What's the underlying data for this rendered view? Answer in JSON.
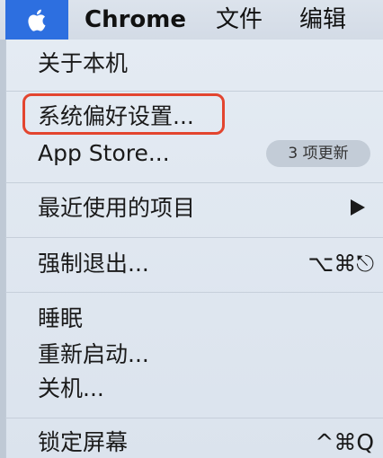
{
  "menubar": {
    "apple_icon": "apple-icon",
    "app_name": "Chrome",
    "menus": [
      "文件",
      "编辑"
    ]
  },
  "apple_menu": {
    "about": "关于本机",
    "system_preferences": "系统偏好设置...",
    "app_store": "App Store...",
    "app_store_badge": "3 项更新",
    "recent_items": "最近使用的项目",
    "recent_items_arrow": "submenu-arrow-icon",
    "force_quit": "强制退出...",
    "force_quit_shortcut": "⌥⌘⎋",
    "sleep": "睡眠",
    "restart": "重新启动...",
    "shutdown": "关机...",
    "lock_screen": "锁定屏幕",
    "lock_screen_shortcut": "^⌘Q"
  },
  "colors": {
    "menubar_highlight": "#2d6fe0",
    "annotation_border": "#e3452f",
    "badge_bg": "#c3ccd7"
  }
}
